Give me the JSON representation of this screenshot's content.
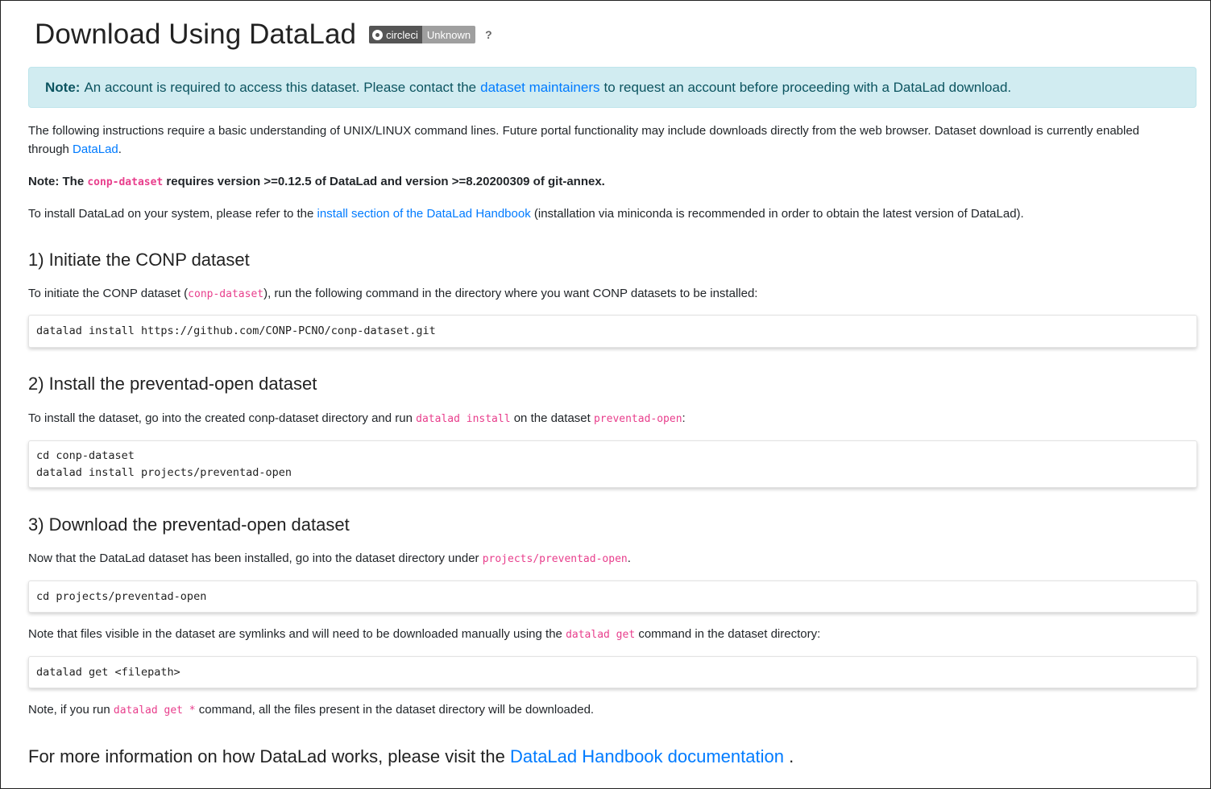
{
  "header": {
    "title": "Download Using DataLad",
    "badge_left": "circleci",
    "badge_right": "Unknown",
    "help": "?"
  },
  "alert": {
    "label": "Note:",
    "before": "An account is required to access this dataset. Please contact the",
    "link": "dataset maintainers",
    "after": "to request an account before proceeding with a DataLad download."
  },
  "intro": {
    "p1_line1": "The following instructions require a basic understanding of UNIX/LINUX command lines. Future portal functionality may include downloads directly from the web browser. Dataset download is currently enabled",
    "p1_line2_prefix": "through ",
    "p1_link": "DataLad",
    "p1_suffix": ".",
    "note_prefix": "Note: The ",
    "note_code": "conp-dataset",
    "note_suffix": " requires version >=0.12.5 of DataLad and version >=8.20200309 of git-annex.",
    "install_prefix": "To install DataLad on your system, please refer to the ",
    "install_link": "install section of the DataLad Handbook",
    "install_suffix": " (installation via miniconda is recommended in order to obtain the latest version of DataLad)."
  },
  "step1": {
    "heading": "1) Initiate the CONP dataset",
    "text_prefix": "To initiate the CONP dataset (",
    "code": "conp-dataset",
    "text_suffix": "), run the following command in the directory where you want CONP datasets to be installed:",
    "command": "datalad install https://github.com/CONP-PCNO/conp-dataset.git"
  },
  "step2": {
    "heading": "2) Install the preventad-open dataset",
    "text_prefix": "To install the dataset, go into the created conp-dataset directory and run ",
    "code1": "datalad install",
    "text_mid": " on the dataset ",
    "code2": "preventad-open",
    "text_suffix": ":",
    "command": "cd conp-dataset\ndatalad install projects/preventad-open"
  },
  "step3": {
    "heading": "3) Download the preventad-open dataset",
    "text_prefix": "Now that the DataLad dataset has been installed, go into the dataset directory under ",
    "code": "projects/preventad-open",
    "text_suffix": ".",
    "command": "cd projects/preventad-open",
    "note_prefix": "Note that files visible in the dataset are symlinks and will need to be downloaded manually using the ",
    "note_code": "datalad get",
    "note_suffix": " command in the dataset directory:",
    "get_command": "datalad get <filepath>",
    "final_prefix": "Note, if you run ",
    "final_code": "datalad get *",
    "final_suffix": " command, all the files present in the dataset directory will be downloaded."
  },
  "footer": {
    "prefix": "For more information on how DataLad works, please visit the ",
    "link": "DataLad Handbook documentation",
    "suffix": " ."
  }
}
